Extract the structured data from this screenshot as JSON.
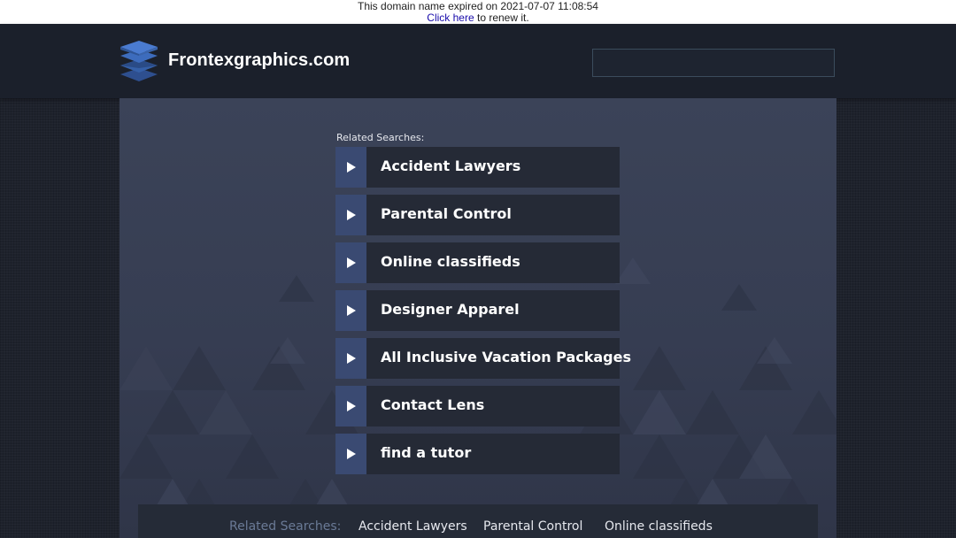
{
  "notice": {
    "expired_text": "This domain name expired on 2021-07-07 11:08:54",
    "renew_link": "Click here",
    "renew_suffix": " to renew it."
  },
  "header": {
    "site_title": "Frontexgraphics.com",
    "logo_icon": "stacked-layers-icon",
    "search_value": ""
  },
  "main": {
    "related_label": "Related Searches:",
    "links": [
      {
        "label": "Accident Lawyers"
      },
      {
        "label": "Parental Control"
      },
      {
        "label": "Online classifieds"
      },
      {
        "label": "Designer Apparel"
      },
      {
        "label": "All Inclusive Vacation Packages"
      },
      {
        "label": "Contact Lens"
      },
      {
        "label": "find a tutor"
      }
    ],
    "arrow_icon": "play-arrow-icon"
  },
  "footer": {
    "label": "Related Searches:",
    "links": [
      {
        "label": "Accident Lawyers"
      },
      {
        "label": "Parental Control"
      },
      {
        "label": "Online classifieds"
      }
    ]
  },
  "colors": {
    "accent": "#3a4a72",
    "link_bg": "#252a36",
    "header_bg": "#1b202b",
    "content_bg": "#3b4358"
  }
}
